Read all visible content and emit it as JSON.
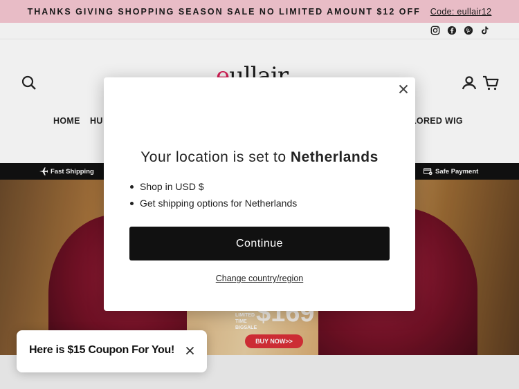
{
  "announcement": {
    "text": "THANKS GIVING SHOPPING SEASON SALE  NO LIMITED AMOUNT $12 OFF",
    "code": "Code: eullair12"
  },
  "social": [
    "instagram-icon",
    "facebook-icon",
    "pinterest-icon",
    "tiktok-icon"
  ],
  "logo": {
    "prefix": "e",
    "rest": "ullair"
  },
  "nav": {
    "home": "HOME",
    "human_partial": "HU",
    "colored_partial": "LORED WIG"
  },
  "strip": {
    "fast_shipping": "Fast Shipping",
    "safe_payment": "Safe Payment"
  },
  "hero": {
    "price": "$169",
    "price_label": "LIMITED TIME BIGSALE",
    "buy_now": "BUY NOW>>"
  },
  "modal": {
    "title_prefix": "Your location is set to ",
    "title_country": "Netherlands",
    "bullet_1": "Shop in USD $",
    "bullet_2": "Get shipping options for Netherlands",
    "continue": "Continue",
    "change": "Change country/region"
  },
  "coupon": {
    "text": "Here is $15 Coupon For You!"
  },
  "colors": {
    "announce_bg": "#f7c8d3",
    "brand_accent": "#e0205a",
    "button_dark": "#111111",
    "buy_red": "#d92f38"
  }
}
